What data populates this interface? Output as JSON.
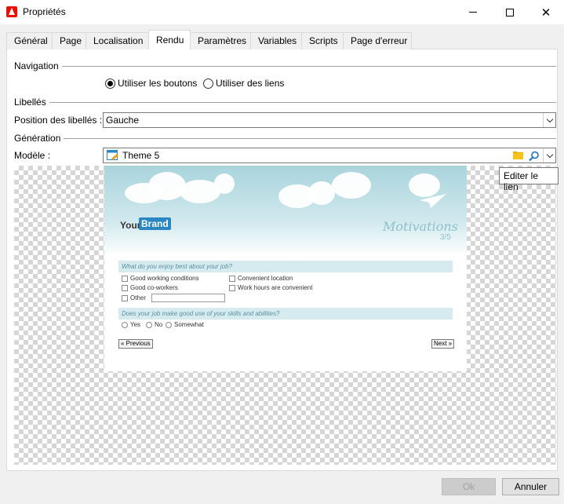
{
  "window": {
    "title": "Propriétés",
    "minimize_icon": "minimize-icon",
    "maximize_icon": "maximize-icon",
    "close_icon": "close-icon",
    "close_glyph": "✕"
  },
  "tabs": [
    {
      "label": "Général",
      "active": false
    },
    {
      "label": "Page",
      "active": false
    },
    {
      "label": "Localisation",
      "active": false
    },
    {
      "label": "Rendu",
      "active": true
    },
    {
      "label": "Paramètres",
      "active": false
    },
    {
      "label": "Variables",
      "active": false
    },
    {
      "label": "Scripts",
      "active": false
    },
    {
      "label": "Page d'erreur",
      "active": false
    }
  ],
  "navigation": {
    "section_label": "Navigation",
    "options": [
      {
        "label": "Utiliser les boutons",
        "selected": true
      },
      {
        "label": "Utiliser des liens",
        "selected": false
      }
    ]
  },
  "labels_section": {
    "section_label": "Libellés",
    "position_label": "Position des libellés :",
    "position_value": "Gauche"
  },
  "generation": {
    "section_label": "Génération",
    "model_label": "Modèle :",
    "model_value": "Theme 5",
    "tooltip": "Editer le lien"
  },
  "preview": {
    "brand_your": "Your",
    "brand_name": "Brand",
    "title": "Motivations",
    "pager": "3/5",
    "question1": "What do you enjoy best about your job?",
    "choices1": [
      "Good working conditions",
      "Good co-workers",
      "Other",
      "Convenient location",
      "Work hours are convenient"
    ],
    "question2": "Does your job make good use of your skills and abilities?",
    "choices2": [
      "Yes",
      "No",
      "Somewhat"
    ],
    "prev_button": "« Previous",
    "next_button": "Next »"
  },
  "footer": {
    "ok_label": "Ok",
    "cancel_label": "Annuler"
  },
  "colors": {
    "accent": "#eb1000",
    "brand_blue": "#2a87c4",
    "sky": "#a9d4dc",
    "question_bar": "#d6ebef"
  }
}
